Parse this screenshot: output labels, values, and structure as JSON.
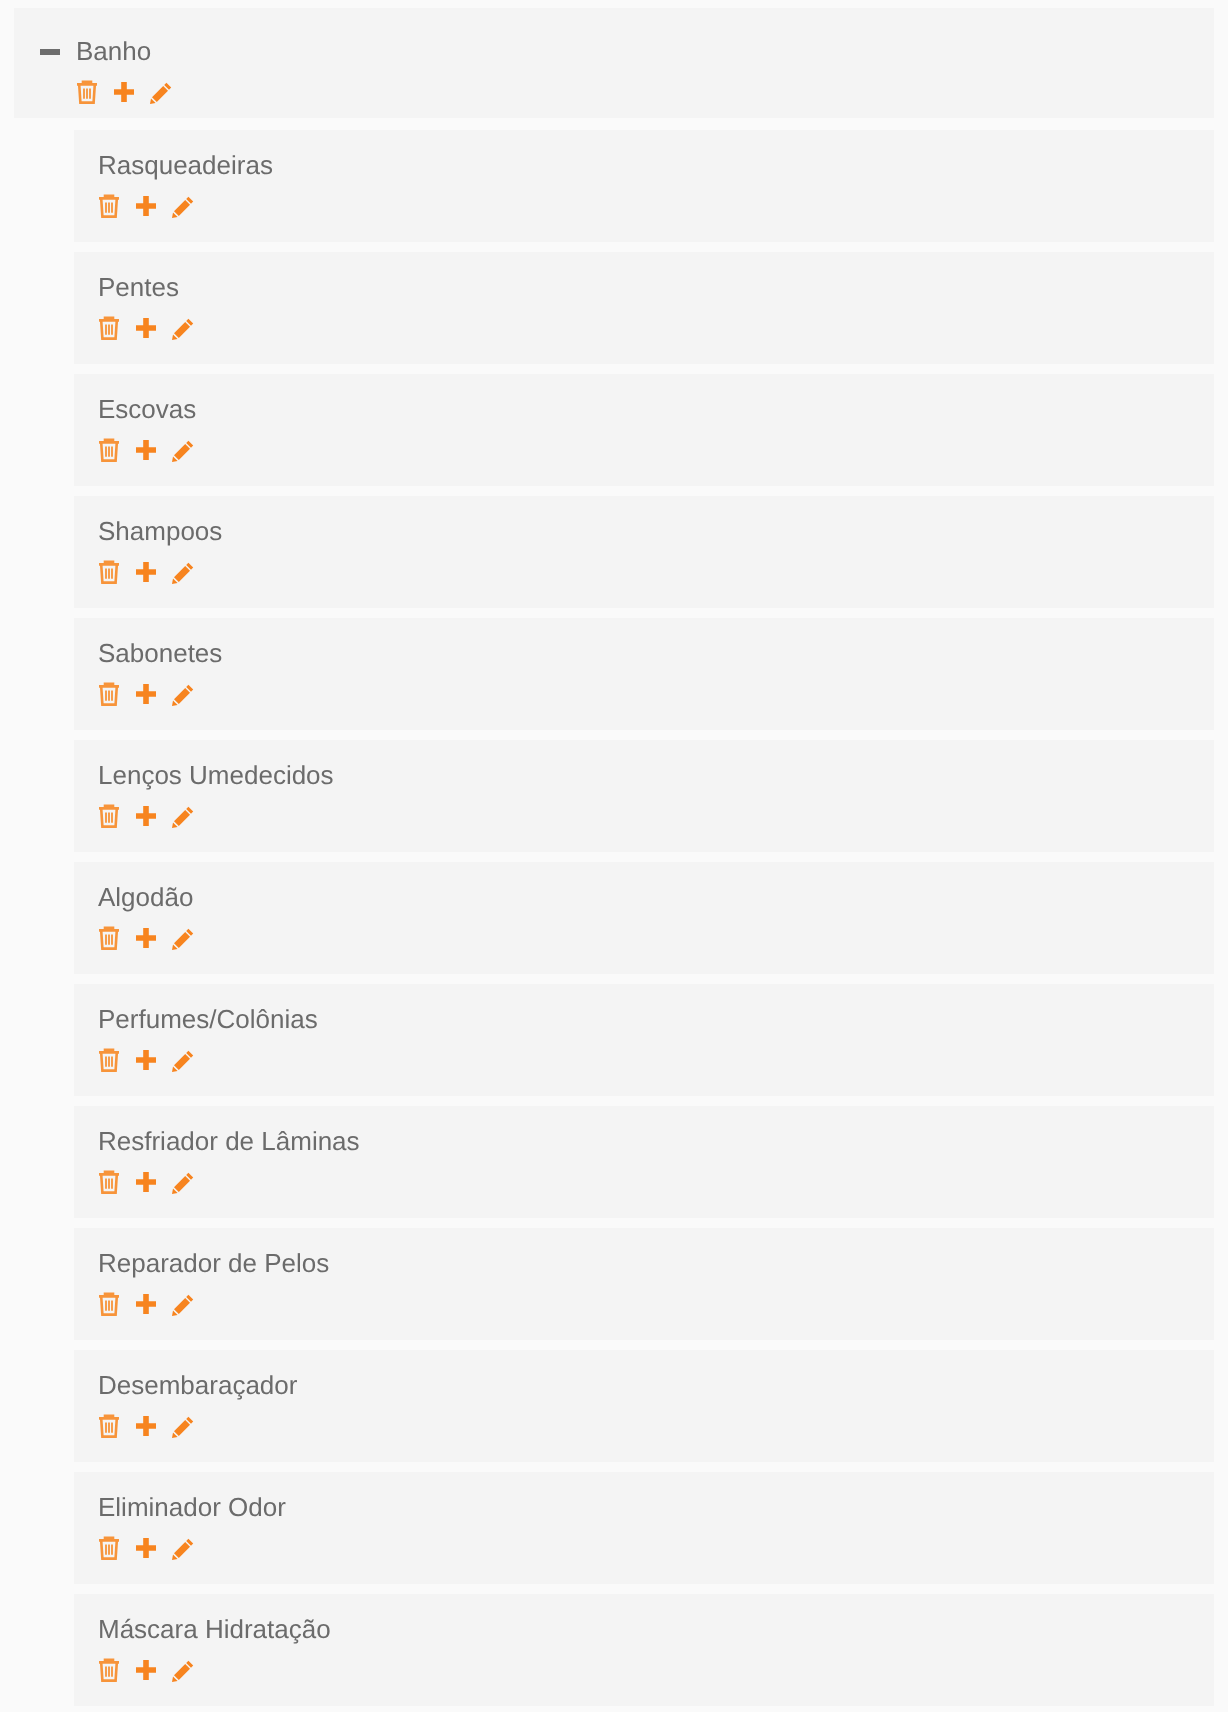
{
  "tree": [
    {
      "label": "Banho",
      "expanded": true,
      "children": [
        {
          "label": "Rasqueadeiras"
        },
        {
          "label": "Pentes"
        },
        {
          "label": "Escovas"
        },
        {
          "label": "Shampoos"
        },
        {
          "label": "Sabonetes"
        },
        {
          "label": "Lenços Umedecidos"
        },
        {
          "label": "Algodão"
        },
        {
          "label": "Perfumes/Colônias"
        },
        {
          "label": "Resfriador de Lâminas"
        },
        {
          "label": "Reparador de Pelos"
        },
        {
          "label": "Desembaraçador"
        },
        {
          "label": "Eliminador Odor"
        },
        {
          "label": "Máscara Hidratação"
        }
      ]
    }
  ]
}
